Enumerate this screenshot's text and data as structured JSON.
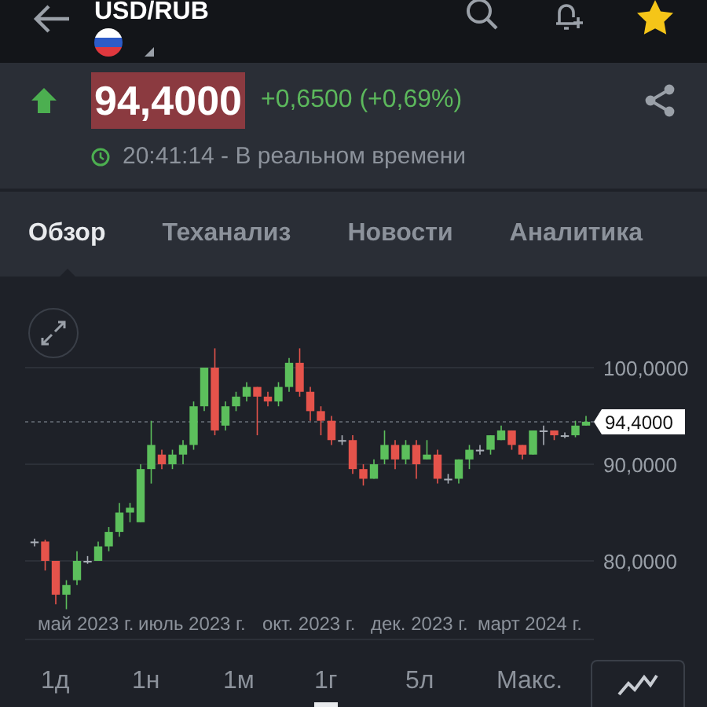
{
  "header": {
    "title": "USD/RUB"
  },
  "quote": {
    "price": "94,4000",
    "change": "+0,6500 (+0,69%)",
    "time": "20:41:14 - В реальном времени"
  },
  "tabs": [
    {
      "label": "Обзор",
      "selected": true
    },
    {
      "label": "Теханализ",
      "selected": false
    },
    {
      "label": "Новости",
      "selected": false
    },
    {
      "label": "Аналитика",
      "selected": false
    }
  ],
  "chart": {
    "y_labels": [
      "100,0000",
      "90,0000",
      "80,0000"
    ],
    "x_labels": [
      "май 2023 г.",
      "июль 2023 г.",
      "окт. 2023 г.",
      "дек. 2023 г.",
      "март 2024 г."
    ],
    "last_price": "94,4000"
  },
  "ranges": [
    {
      "label": "1д",
      "selected": false
    },
    {
      "label": "1н",
      "selected": false
    },
    {
      "label": "1м",
      "selected": false
    },
    {
      "label": "1г",
      "selected": true
    },
    {
      "label": "5л",
      "selected": false
    },
    {
      "label": "Макс.",
      "selected": false
    }
  ]
}
